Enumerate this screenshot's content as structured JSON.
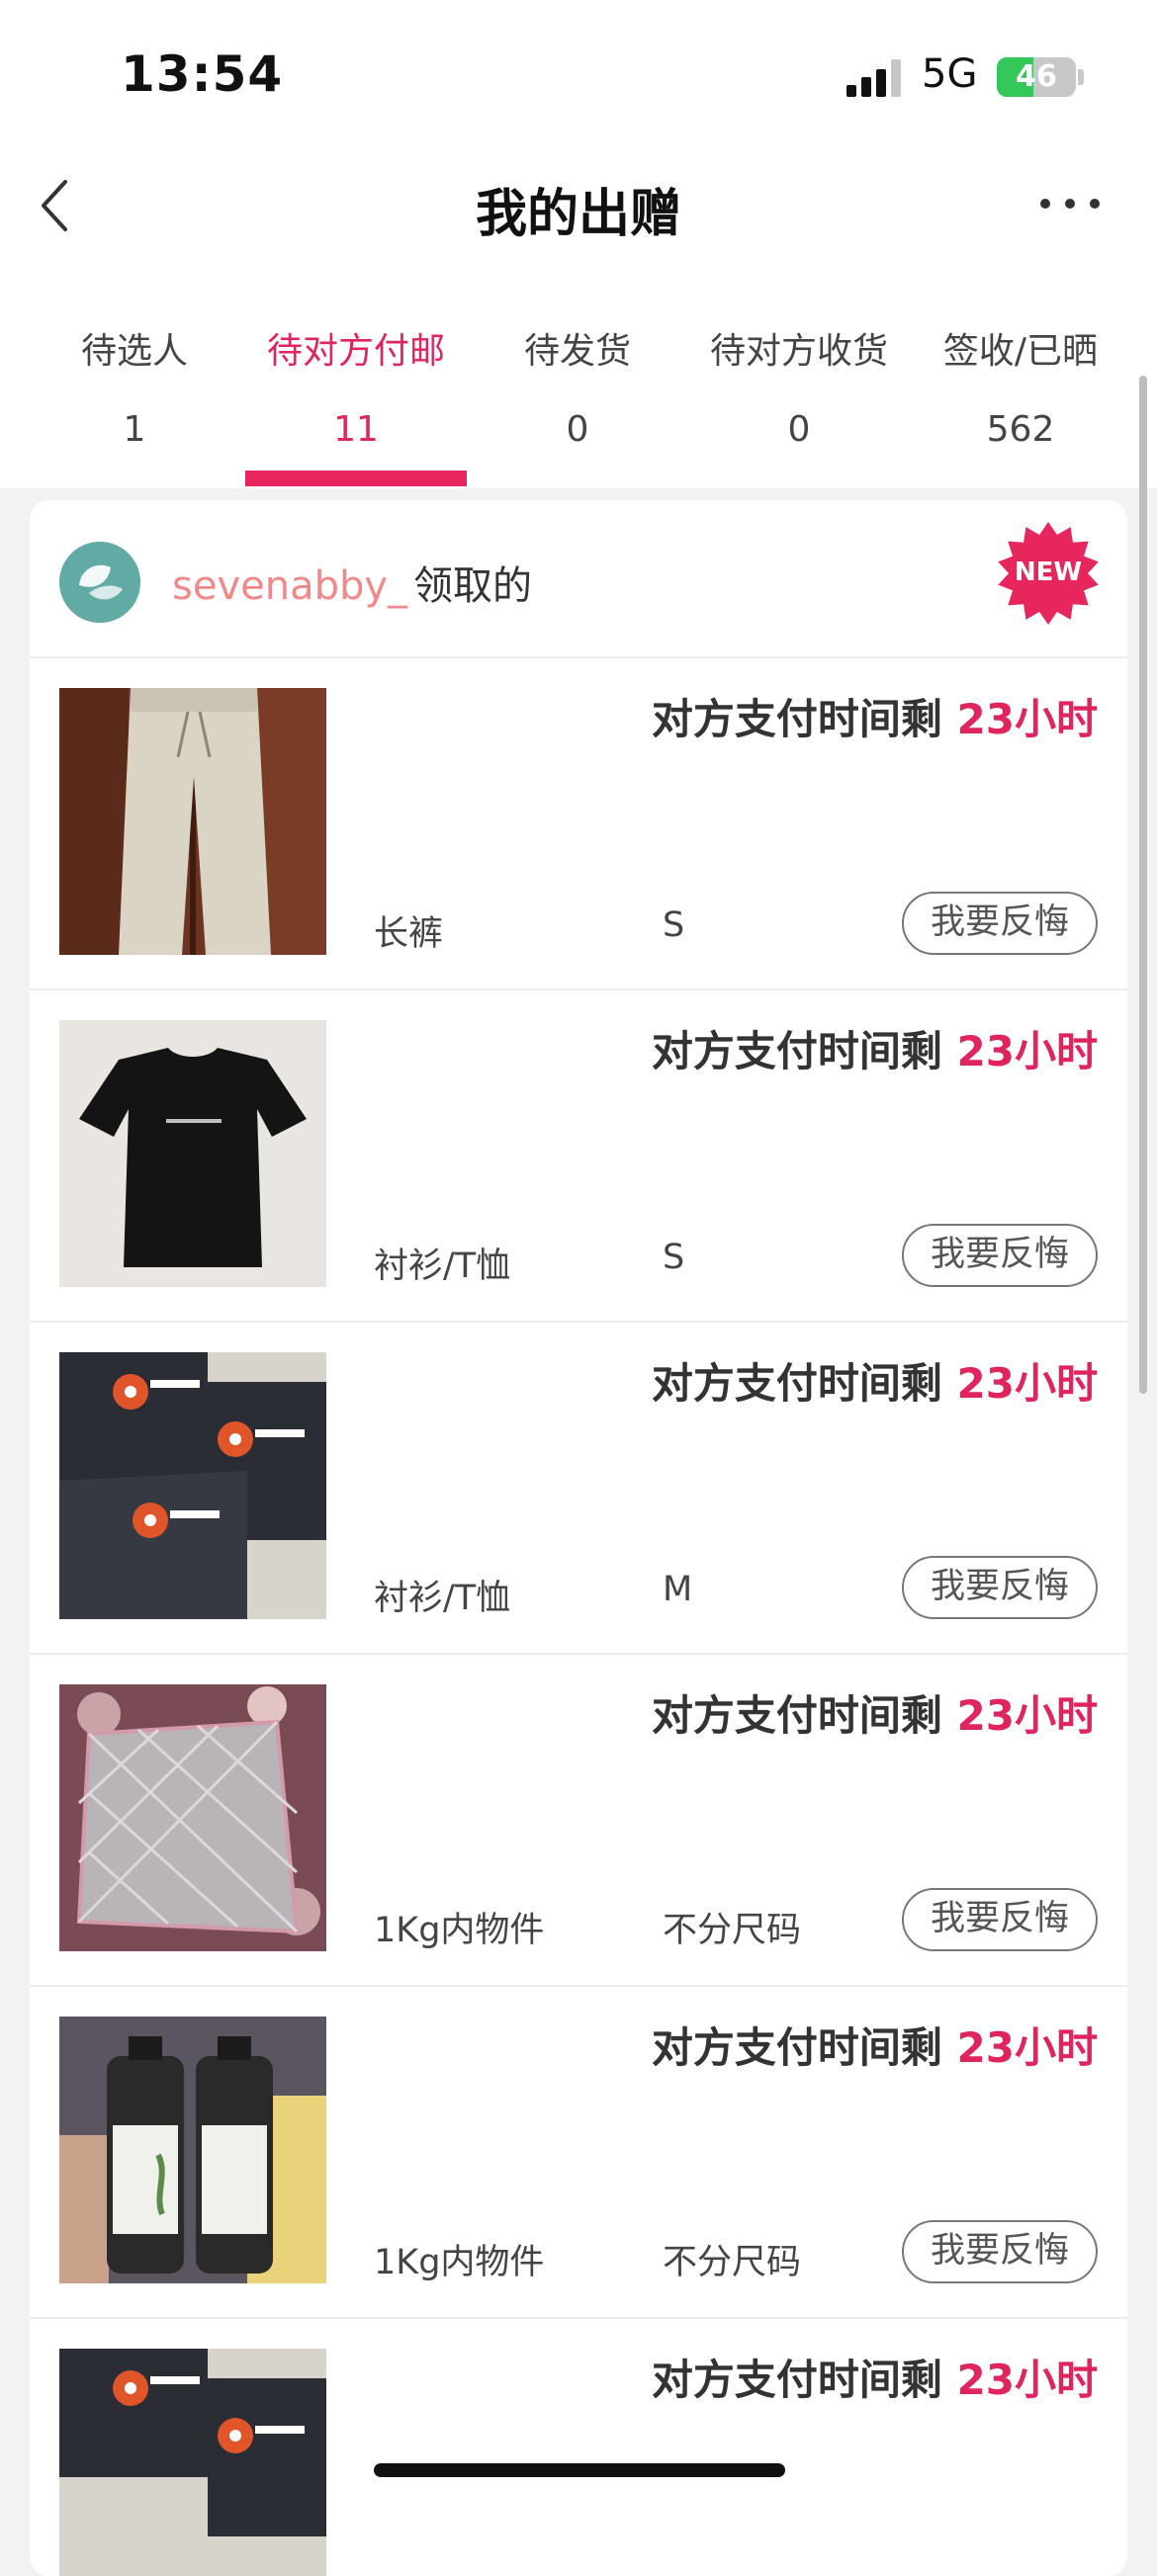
{
  "status_bar": {
    "time": "13:54",
    "network": "5G",
    "battery": "46",
    "battery_level": 0.46
  },
  "nav": {
    "title": "我的出赠"
  },
  "tabs": [
    {
      "label": "待选人",
      "count": "1"
    },
    {
      "label": "待对方付邮",
      "count": "11"
    },
    {
      "label": "待发货",
      "count": "0"
    },
    {
      "label": "待对方收货",
      "count": "0"
    },
    {
      "label": "签收/已晒",
      "count": "562"
    }
  ],
  "colors": {
    "accent": "#e8265e",
    "username": "#f08a8a",
    "avatar": "#62aaa4"
  },
  "card": {
    "username": "sevenabby_",
    "claimed_suffix": "领取的",
    "badge": "NEW",
    "items": [
      {
        "timer_prefix": "对方支付时间剩 ",
        "timer_value": "23小时",
        "category": "长裤",
        "size": "S",
        "action": "我要反悔",
        "image": "beige-pants"
      },
      {
        "timer_prefix": "对方支付时间剩 ",
        "timer_value": "23小时",
        "category": "衬衫/T恤",
        "size": "S",
        "action": "我要反悔",
        "image": "black-tshirt"
      },
      {
        "timer_prefix": "对方支付时间剩 ",
        "timer_value": "23小时",
        "category": "衬衫/T恤",
        "size": "M",
        "action": "我要反悔",
        "image": "black-tshirts-print"
      },
      {
        "timer_prefix": "对方支付时间剩 ",
        "timer_value": "23小时",
        "category": "1Kg内物件",
        "size": "不分尺码",
        "action": "我要反悔",
        "image": "quilted-pad"
      },
      {
        "timer_prefix": "对方支付时间剩 ",
        "timer_value": "23小时",
        "category": "1Kg内物件",
        "size": "不分尺码",
        "action": "我要反悔",
        "image": "two-bottles"
      },
      {
        "timer_prefix": "对方支付时间剩 ",
        "timer_value": "23小时",
        "category": "",
        "size": "",
        "action": "",
        "image": "black-tshirts-print"
      }
    ]
  }
}
